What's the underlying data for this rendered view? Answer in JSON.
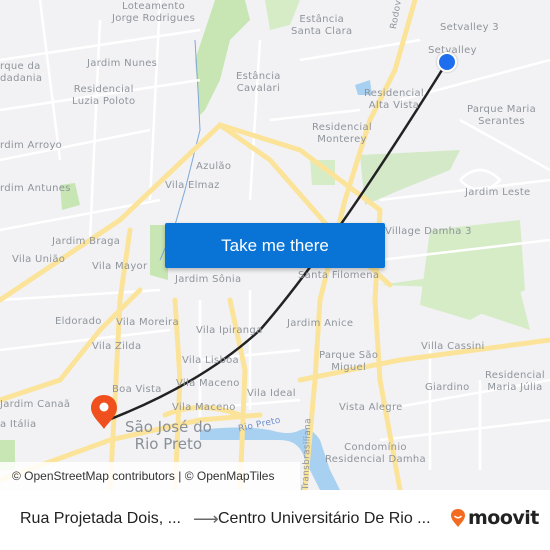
{
  "map": {
    "labels": [
      {
        "text": "Loteamento\nJorge Rodrigues"
      },
      {
        "text": "Estância\nSanta Clara"
      },
      {
        "text": "Setvalley 3"
      },
      {
        "text": "Setvalley"
      },
      {
        "text": "rque da\ndadania"
      },
      {
        "text": "Jardim Nunes"
      },
      {
        "text": "Estância\nCavalari"
      },
      {
        "text": "Residencial\nLuzia Poloto"
      },
      {
        "text": "Residencial\nAlta Vista"
      },
      {
        "text": "Parque Maria\nSerantes"
      },
      {
        "text": "Residencial\nMonterey"
      },
      {
        "text": "rdim Arroyo"
      },
      {
        "text": "Azulão"
      },
      {
        "text": "Vila Elmaz"
      },
      {
        "text": "rdim Antunes"
      },
      {
        "text": "Jardim Leste"
      },
      {
        "text": "Jardim Braga"
      },
      {
        "text": "Village Damha 3"
      },
      {
        "text": "Vila União"
      },
      {
        "text": "Vila Mayor"
      },
      {
        "text": "Jardim Sônia"
      },
      {
        "text": "Santa Filomena"
      },
      {
        "text": "Eldorado"
      },
      {
        "text": "Vila Moreira"
      },
      {
        "text": "Vila Ipiranga"
      },
      {
        "text": "Jardim Anice"
      },
      {
        "text": "Vila Zilda"
      },
      {
        "text": "Vila Lisboa"
      },
      {
        "text": "Parque São\nMiguel"
      },
      {
        "text": "Villa Cassini"
      },
      {
        "text": "Boa Vista"
      },
      {
        "text": "Vila Maceno"
      },
      {
        "text": "Vila Ideal"
      },
      {
        "text": "Giardino"
      },
      {
        "text": "Residencial\nMaria Júlia"
      },
      {
        "text": "Jardim Canaã"
      },
      {
        "text": "Vila Maceno"
      },
      {
        "text": "Vista Alegre"
      },
      {
        "text": "a Itália"
      },
      {
        "text": "Condomínio\nResidencial Damha"
      }
    ],
    "city_label": "São José do\nRio Preto",
    "river_label": "Rio Preto",
    "road_label_rodovia": "Rodovia T",
    "road_label_transbrasiliana": "Transbrasiliana",
    "origin_marker": "origin-dot",
    "destination_marker": "destination-pin",
    "colors": {
      "background": "#f2f2f4",
      "major_road": "#fbe49a",
      "park": "#c8e6b4",
      "water": "#a8d0f0",
      "route": "#222222",
      "origin": "#1e6ff0",
      "destination": "#f0501e",
      "cta": "#0a74d6"
    }
  },
  "cta": {
    "label": "Take me there"
  },
  "attribution": "© OpenStreetMap contributors | © OpenMapTiles",
  "footer": {
    "from": "Rua Projetada Dois, ...",
    "arrow": "⟶",
    "to": "Centro Universitário De Rio ...",
    "brand": "moovit"
  }
}
